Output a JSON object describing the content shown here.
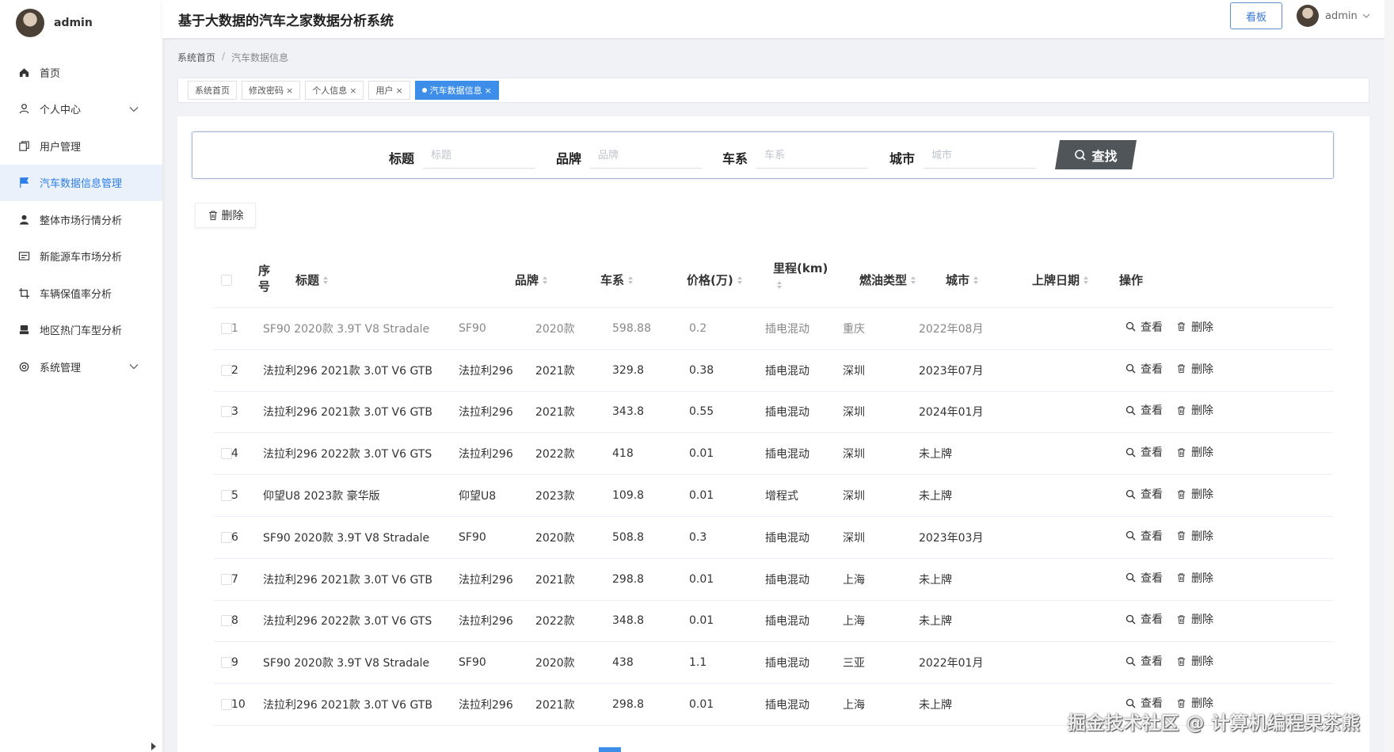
{
  "app": {
    "title": "基于大数据的汽车之家数据分析系统",
    "board_label": "看板",
    "username": "admin"
  },
  "sidebar": {
    "username": "admin",
    "items": [
      {
        "label": "首页",
        "icon": "home-icon"
      },
      {
        "label": "个人中心",
        "icon": "user-icon",
        "expandable": true
      },
      {
        "label": "用户管理",
        "icon": "copy-icon"
      },
      {
        "label": "汽车数据信息管理",
        "icon": "flag-icon",
        "active": true
      },
      {
        "label": "整体市场行情分析",
        "icon": "person-icon"
      },
      {
        "label": "新能源车市场分析",
        "icon": "card-icon"
      },
      {
        "label": "车辆保值率分析",
        "icon": "crop-icon"
      },
      {
        "label": "地区热门车型分析",
        "icon": "stamp-icon"
      },
      {
        "label": "系统管理",
        "icon": "gear-icon",
        "expandable": true
      }
    ]
  },
  "breadcrumb": {
    "home": "系统首页",
    "separator": "/",
    "current": "汽车数据信息"
  },
  "tags": [
    {
      "label": "系统首页",
      "closable": false
    },
    {
      "label": "修改密码",
      "closable": true
    },
    {
      "label": "个人信息",
      "closable": true
    },
    {
      "label": "用户",
      "closable": true
    },
    {
      "label": "汽车数据信息",
      "closable": true,
      "active": true
    }
  ],
  "search": {
    "fields": [
      {
        "label": "标题",
        "placeholder": "标题"
      },
      {
        "label": "品牌",
        "placeholder": "品牌"
      },
      {
        "label": "车系",
        "placeholder": "车系"
      },
      {
        "label": "城市",
        "placeholder": "城市"
      }
    ],
    "button_label": "查找"
  },
  "toolbar": {
    "delete_label": "删除"
  },
  "table": {
    "columns": {
      "index": "序号",
      "title": "标题",
      "brand": "品牌",
      "series": "车系",
      "price": "价格(万)",
      "mileage": "里程(km)",
      "fuel": "燃油类型",
      "city": "城市",
      "reg_date": "上牌日期",
      "ops": "操作"
    },
    "view_label": "查看",
    "delete_label": "删除",
    "rows": [
      {
        "index": "1",
        "title": "SF90 2020款 3.9T V8 Stradale",
        "brand": "SF90",
        "series": "2020款",
        "price": "598.88",
        "mileage": "0.2",
        "fuel": "插电混动",
        "city": "重庆",
        "reg_date": "2022年08月"
      },
      {
        "index": "2",
        "title": "法拉利296 2021款 3.0T V6 GTB",
        "brand": "法拉利296",
        "series": "2021款",
        "price": "329.8",
        "mileage": "0.38",
        "fuel": "插电混动",
        "city": "深圳",
        "reg_date": "2023年07月"
      },
      {
        "index": "3",
        "title": "法拉利296 2021款 3.0T V6 GTB",
        "brand": "法拉利296",
        "series": "2021款",
        "price": "343.8",
        "mileage": "0.55",
        "fuel": "插电混动",
        "city": "深圳",
        "reg_date": "2024年01月"
      },
      {
        "index": "4",
        "title": "法拉利296 2022款 3.0T V6 GTS",
        "brand": "法拉利296",
        "series": "2022款",
        "price": "418",
        "mileage": "0.01",
        "fuel": "插电混动",
        "city": "深圳",
        "reg_date": "未上牌"
      },
      {
        "index": "5",
        "title": "仰望U8 2023款 豪华版",
        "brand": "仰望U8",
        "series": "2023款",
        "price": "109.8",
        "mileage": "0.01",
        "fuel": "增程式",
        "city": "深圳",
        "reg_date": "未上牌"
      },
      {
        "index": "6",
        "title": "SF90 2020款 3.9T V8 Stradale",
        "brand": "SF90",
        "series": "2020款",
        "price": "508.8",
        "mileage": "0.3",
        "fuel": "插电混动",
        "city": "深圳",
        "reg_date": "2023年03月"
      },
      {
        "index": "7",
        "title": "法拉利296 2021款 3.0T V6 GTB",
        "brand": "法拉利296",
        "series": "2021款",
        "price": "298.8",
        "mileage": "0.01",
        "fuel": "插电混动",
        "city": "上海",
        "reg_date": "未上牌"
      },
      {
        "index": "8",
        "title": "法拉利296 2022款 3.0T V6 GTS",
        "brand": "法拉利296",
        "series": "2022款",
        "price": "348.8",
        "mileage": "0.01",
        "fuel": "插电混动",
        "city": "上海",
        "reg_date": "未上牌"
      },
      {
        "index": "9",
        "title": "SF90 2020款 3.9T V8 Stradale",
        "brand": "SF90",
        "series": "2020款",
        "price": "438",
        "mileage": "1.1",
        "fuel": "插电混动",
        "city": "三亚",
        "reg_date": "2022年01月"
      },
      {
        "index": "10",
        "title": "法拉利296 2021款 3.0T V6 GTB",
        "brand": "法拉利296",
        "series": "2021款",
        "price": "298.8",
        "mileage": "0.01",
        "fuel": "插电混动",
        "city": "上海",
        "reg_date": "未上牌"
      }
    ]
  },
  "watermark": "掘金技术社区 @ 计算机编程果茶熊",
  "colors": {
    "accent": "#3d8ee8",
    "active_menu_bg": "#eaf1fa",
    "search_button": "#4f5559"
  }
}
